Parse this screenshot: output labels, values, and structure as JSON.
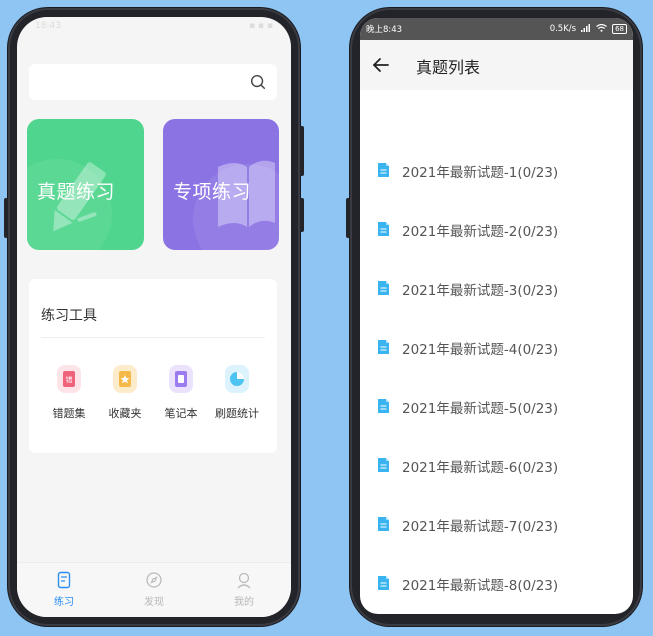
{
  "left_screen": {
    "status_time": "18:43",
    "search": {
      "placeholder": ""
    },
    "cards": [
      {
        "label": "真题练习",
        "color": "#4fd58d"
      },
      {
        "label": "专项练习",
        "color": "#8b73e4"
      }
    ],
    "tools": {
      "title": "练习工具",
      "items": [
        {
          "label": "错题集",
          "icon": "wrong-book-icon",
          "color": "#f0617a"
        },
        {
          "label": "收藏夹",
          "icon": "favorites-icon",
          "color": "#f5b94a"
        },
        {
          "label": "笔记本",
          "icon": "notebook-icon",
          "color": "#9a7cf0"
        },
        {
          "label": "刷题统计",
          "icon": "statistics-icon",
          "color": "#4cc3f0"
        }
      ]
    },
    "tabbar": {
      "tabs": [
        {
          "label": "练习",
          "icon": "practice-icon",
          "active": true
        },
        {
          "label": "发现",
          "icon": "discover-icon",
          "active": false
        },
        {
          "label": "我的",
          "icon": "profile-icon",
          "active": false
        }
      ],
      "active_color": "#2a8ff0"
    }
  },
  "right_screen": {
    "status_left": "晚上8:43",
    "status_right": "0.5K/s",
    "battery": "68",
    "title": "真题列表",
    "items": [
      "2021年最新试题-1(0/23)",
      "2021年最新试题-2(0/23)",
      "2021年最新试题-3(0/23)",
      "2021年最新试题-4(0/23)",
      "2021年最新试题-5(0/23)",
      "2021年最新试题-6(0/23)",
      "2021年最新试题-7(0/23)",
      "2021年最新试题-8(0/23)"
    ],
    "doc_icon_color": "#3ab4f0"
  }
}
